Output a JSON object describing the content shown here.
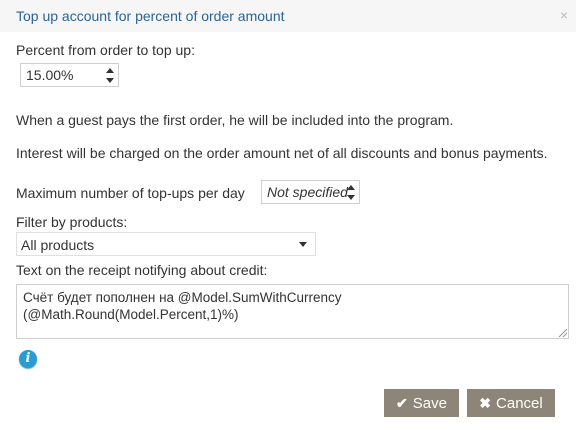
{
  "dialog": {
    "title": "Top up account for percent of order amount",
    "close_icon": "×"
  },
  "form": {
    "percent_label": "Percent from order to top up:",
    "percent_value": "15.00%",
    "info_line_1": "When a guest pays the first order, he will be included into the program.",
    "info_line_2": "Interest will be charged on the order amount net of all discounts and bonus payments.",
    "max_topups_label": "Maximum number of top-ups per day",
    "max_topups_value": "Not specified",
    "filter_label": "Filter by products:",
    "filter_value": "All products",
    "receipt_label": "Text on the receipt notifying about credit:",
    "receipt_text": "Счёт будет пополнен на @Model.SumWithCurrency\n(@Math.Round(Model.Percent,1)%)",
    "info_icon": "i"
  },
  "buttons": {
    "save_icon": "✔",
    "save_label": "Save",
    "cancel_icon": "✖",
    "cancel_label": "Cancel"
  },
  "colors": {
    "title": "#2a6496",
    "button_bg": "#8d8577",
    "info_icon": "#2a9bd4"
  }
}
